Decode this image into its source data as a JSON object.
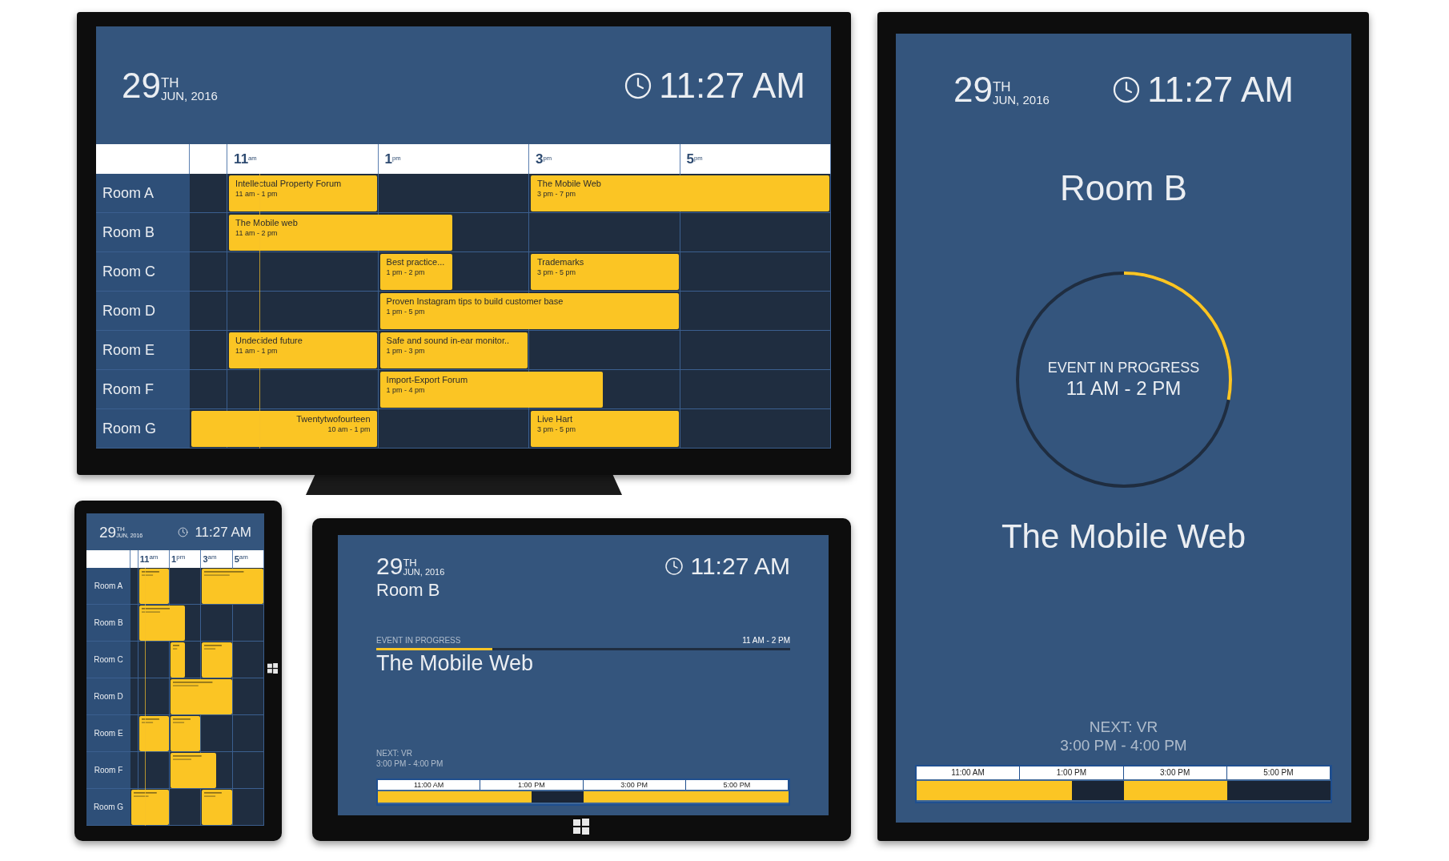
{
  "tv": {
    "date": {
      "day": "29",
      "suffix": "TH",
      "month": "JUN, 2016"
    },
    "time": "11:27 AM",
    "schedule": {
      "hours": [
        "11$^{am}$",
        "1$^{pm}$",
        "3$^{pm}$",
        "5$^{pm}$"
      ],
      "rooms": [
        {
          "name": "Room A",
          "events": [
            {
              "title": "Intellectual Property Forum",
              "time": "11 am - 1 pm"
            },
            {
              "title": "The Mobile Web",
              "time": "3 pm - 7 pm"
            }
          ]
        },
        {
          "name": "Room B",
          "events": [
            {
              "title": "The Mobile web",
              "time": "11 am - 2 pm"
            }
          ]
        },
        {
          "name": "Room C",
          "events": [
            {
              "title": "Best practice...",
              "time": "1 pm - 2 pm"
            },
            {
              "title": "Trademarks",
              "time": "3 pm -  5 pm"
            }
          ]
        },
        {
          "name": "Room D",
          "events": [
            {
              "title": "Proven Instagram tips to build customer base",
              "time": "1 pm - 5 pm"
            }
          ]
        },
        {
          "name": "Room E",
          "events": [
            {
              "title": "Undecided future",
              "time": "11 am - 1 pm"
            },
            {
              "title": "Safe and sound in-ear monitor..",
              "time": "1 pm - 3 pm"
            }
          ]
        },
        {
          "name": "Room F",
          "events": [
            {
              "title": "Import-Export Forum",
              "time": "1 pm - 4 pm"
            }
          ]
        },
        {
          "name": "Room G",
          "events": [
            {
              "title": "Twentytwofourteen",
              "time": "10 am - 1 pm"
            },
            {
              "title": "Live Hart",
              "time": "3 pm -  5 pm"
            }
          ]
        }
      ]
    }
  },
  "tablet_small": {
    "date": {
      "day": "29",
      "suffix": "TH",
      "month": "JUN, 2016"
    },
    "time": "11:27 AM",
    "schedule": {
      "hours": [
        "11$^{am}$",
        "1$^{pm}$",
        "3$^{am}$",
        "5$^{am}$"
      ],
      "rooms": [
        {
          "name": "Room A",
          "events": [
            {
              "kind": "event"
            },
            {
              "kind": "event"
            }
          ]
        },
        {
          "name": "Room B",
          "events": [
            {
              "kind": "event"
            }
          ]
        },
        {
          "name": "Room C",
          "events": [
            {
              "kind": "event"
            },
            {
              "kind": "event"
            }
          ]
        },
        {
          "name": "Room D",
          "events": [
            {
              "kind": "event"
            }
          ]
        },
        {
          "name": "Room E",
          "events": [
            {
              "kind": "event"
            },
            {
              "kind": "event"
            }
          ]
        },
        {
          "name": "Room F",
          "events": [
            {
              "kind": "event"
            }
          ]
        },
        {
          "name": "Room G",
          "events": [
            {
              "kind": "event"
            },
            {
              "kind": "event"
            }
          ]
        }
      ]
    }
  },
  "tablet_wide": {
    "date": {
      "day": "29",
      "suffix": "TH",
      "month": "JUN, 2016"
    },
    "time": "11:27 AM",
    "room": "Room B",
    "status": "EVENT IN PROGRESS",
    "range": "11 AM - 2 PM",
    "level": 0.28,
    "event": "The Mobile Web",
    "next": "NEXT: VR",
    "next_time": "3:00 PM - 4:00 PM",
    "timeline": {
      "hours": [
        "11:00 AM",
        "1:00 PM",
        "3:00 PM",
        "5:00 PM"
      ],
      "segments": [
        {
          "busy": true
        },
        {
          "busy": true
        },
        {
          "busy": true
        },
        {
          "busy": false
        },
        {
          "busy": true
        },
        {
          "busy": true
        },
        {
          "busy": true
        },
        {
          "busy": true
        }
      ]
    }
  },
  "portrait": {
    "date": {
      "day": "29",
      "suffix": "TH",
      "month": "JUN, 2016"
    },
    "time": "11:27 AM",
    "room": "Room B",
    "status": "EVENT IN PROGRESS",
    "range": "11 AM - 2 PM",
    "level": 0.28,
    "event": "The Mobile Web",
    "next": "NEXT: VR",
    "next_time": "3:00 PM - 4:00 PM",
    "timeline": {
      "hours": [
        "11:00 AM",
        "1:00 PM",
        "3:00 PM",
        "5:00 PM"
      ],
      "segments": [
        {
          "busy": true
        },
        {
          "busy": true
        },
        {
          "busy": true
        },
        {
          "busy": false
        },
        {
          "busy": true
        },
        {
          "busy": true
        },
        {
          "busy": false
        },
        {
          "busy": false
        }
      ]
    }
  }
}
